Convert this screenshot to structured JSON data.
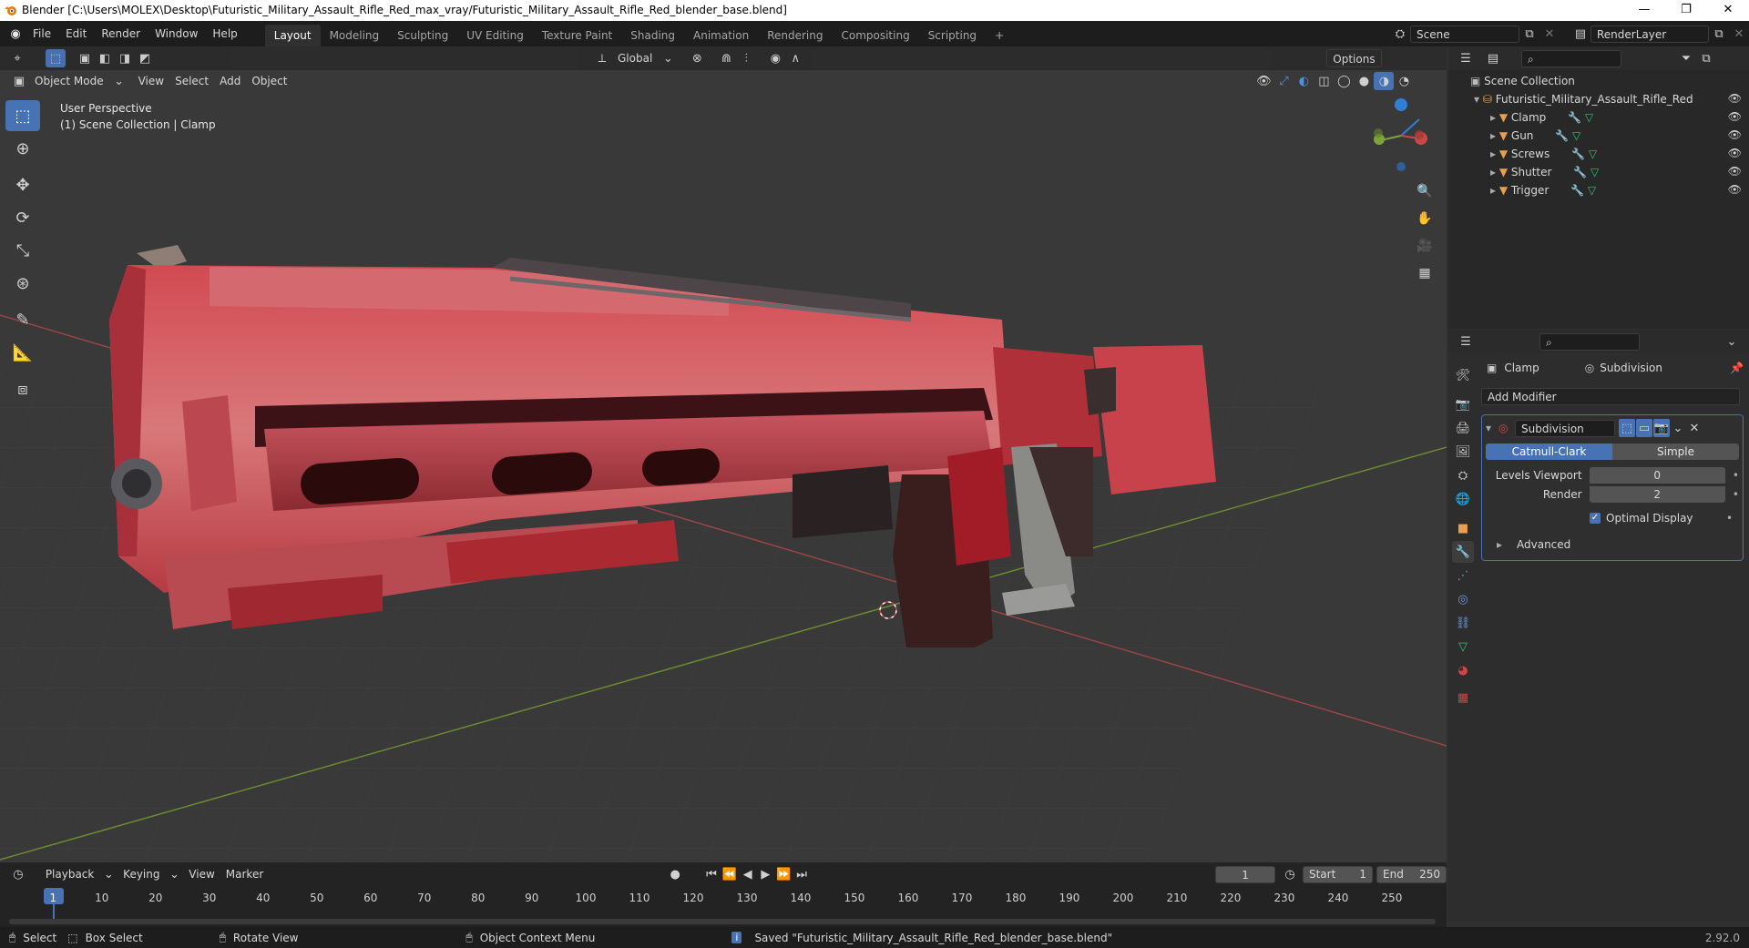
{
  "window": {
    "title": "Blender [C:\\Users\\MOLEX\\Desktop\\Futuristic_Military_Assault_Rifle_Red_max_vray/Futuristic_Military_Assault_Rifle_Red_blender_base.blend]",
    "minimize": "—",
    "restore": "❐",
    "close": "✕"
  },
  "menu": {
    "items": [
      "File",
      "Edit",
      "Render",
      "Window",
      "Help"
    ]
  },
  "workspaces": {
    "tabs": [
      "Layout",
      "Modeling",
      "Sculpting",
      "UV Editing",
      "Texture Paint",
      "Shading",
      "Animation",
      "Rendering",
      "Compositing",
      "Scripting"
    ],
    "add": "+"
  },
  "scene": {
    "name": "Scene",
    "render_layer": "RenderLayer"
  },
  "viewport_header": {
    "orientation": "Global",
    "options": "Options",
    "mode": "Object Mode",
    "menus": [
      "View",
      "Select",
      "Add",
      "Object"
    ]
  },
  "viewport": {
    "perspective": "User Perspective",
    "collection_info": "(1) Scene Collection | Clamp"
  },
  "outliner": {
    "root": "Scene Collection",
    "collection": "Futuristic_Military_Assault_Rifle_Red",
    "objects": [
      "Clamp",
      "Gun",
      "Screws",
      "Shutter",
      "Trigger"
    ]
  },
  "properties": {
    "object": "Clamp",
    "modifier_name_tab": "Subdivision",
    "add_modifier": "Add Modifier",
    "modifier": {
      "name": "Subdivision",
      "type_options": [
        "Catmull-Clark",
        "Simple"
      ],
      "selected_type": "Catmull-Clark",
      "levels_viewport_label": "Levels Viewport",
      "levels_viewport": "0",
      "render_label": "Render",
      "render": "2",
      "optimal_display_label": "Optimal Display",
      "optimal_display": true,
      "advanced": "Advanced"
    }
  },
  "timeline": {
    "menus": [
      "Playback",
      "Keying",
      "View",
      "Marker"
    ],
    "current_frame": "1",
    "start_label": "Start",
    "start": "1",
    "end_label": "End",
    "end": "250",
    "ticks": [
      "1",
      "10",
      "20",
      "30",
      "40",
      "50",
      "60",
      "70",
      "80",
      "90",
      "100",
      "110",
      "120",
      "130",
      "140",
      "150",
      "160",
      "170",
      "180",
      "190",
      "200",
      "210",
      "220",
      "230",
      "240",
      "250"
    ]
  },
  "statusbar": {
    "select": "Select",
    "box_select": "Box Select",
    "rotate_view": "Rotate View",
    "context_menu": "Object Context Menu",
    "message": "Saved \"Futuristic_Military_Assault_Rifle_Red_blender_base.blend\"",
    "version": "2.92.0"
  },
  "colors": {
    "accent": "#4772b3",
    "x_axis": "#c84848",
    "y_axis": "#7ea33a",
    "z_axis": "#2f7fd9",
    "rifle_red": "#c9303a"
  }
}
